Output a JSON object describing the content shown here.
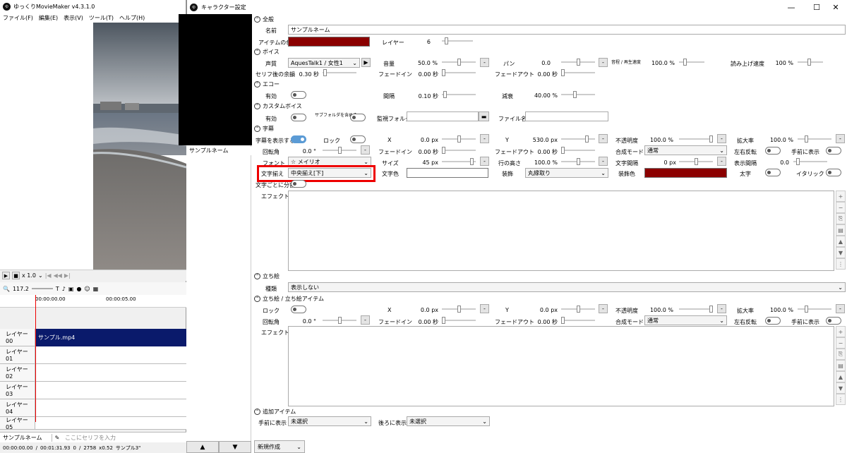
{
  "main": {
    "title": "ゆっくりMovieMaker v4.3.1.0",
    "menu": [
      "ファイル(F)",
      "編集(E)",
      "表示(V)",
      "ツール(T)",
      "ヘルプ(H)"
    ],
    "play_speed": "x 1.0",
    "zoom": "117.2",
    "ruler_t0": "00:00:00.00",
    "ruler_t1": "00:00:05.00",
    "layers": [
      "レイヤー 00",
      "レイヤー 01",
      "レイヤー 02",
      "レイヤー 03",
      "レイヤー 04",
      "レイヤー 05"
    ],
    "clip_label": "サンプル.mp4",
    "character_select": "サンプルネーム",
    "serif_placeholder": "ここにセリフを入力",
    "status": [
      "00:00:00.00",
      "/",
      "00:01:31.93",
      "0",
      "/",
      "2758",
      "x0.52",
      "サンプル3\""
    ]
  },
  "char": {
    "title": "キャラクター設定",
    "list_item": "サンプルネーム",
    "sections": {
      "general": "全般",
      "voice": "ボイス",
      "echo": "エコー",
      "custom_voice": "カスタムボイス",
      "subtitle": "字幕",
      "standing": "立ち絵",
      "standing_item": "立ち絵 / 立ち絵アイテム",
      "extra": "追加アイテム"
    },
    "general": {
      "name_label": "名前",
      "name_value": "サンプルネーム",
      "color_label": "アイテムの色",
      "item_color": "#8b0000",
      "layer_label": "レイヤー",
      "layer_value": "6"
    },
    "voice": {
      "voice_label": "声質",
      "voice_value": "AquesTalk1 / 女性1",
      "volume_label": "音量",
      "volume_value": "50.0 %",
      "pan_label": "パン",
      "pan_value": "0.0",
      "play_speed_label": "音程 / 再生速度",
      "play_speed_value": "100.0 %",
      "read_speed_label": "読み上げ速度",
      "read_speed_value": "100 %",
      "after_label": "セリフ後の余韻",
      "after_value": "0.30 秒",
      "fadein_label": "フェードイン",
      "fadein_value": "0.00 秒",
      "fadeout_label": "フェードアウト",
      "fadeout_value": "0.00 秒"
    },
    "echo": {
      "enabled_label": "有効",
      "interval_label": "間隔",
      "interval_value": "0.10 秒",
      "decay_label": "減衰",
      "decay_value": "40.00 %"
    },
    "custom": {
      "enabled_label": "有効",
      "use_default_label": "サブフォルダを含める",
      "watch_label": "監視フォルダ",
      "file_label": "ファイル名"
    },
    "subtitle": {
      "show_label": "字幕を表示する",
      "lock_label": "ロック",
      "x_label": "X",
      "x_value": "0.0 px",
      "y_label": "Y",
      "y_value": "530.0 px",
      "opacity_label": "不透明度",
      "opacity_value": "100.0 %",
      "zoom_label": "拡大率",
      "zoom_value": "100.0 %",
      "rotate_label": "回転角",
      "rotate_value": "0.0 °",
      "fadein_label": "フェードイン",
      "fadein_value": "0.00 秒",
      "fadeout_label": "フェードアウト",
      "fadeout_value": "0.00 秒",
      "blend_label": "合成モード",
      "blend_value": "通常",
      "flip_label": "左右反転",
      "front_label": "手前に表示",
      "font_label": "フォント",
      "font_value": "メイリオ",
      "size_label": "サイズ",
      "size_value": "45 px",
      "line_label": "行の高さ",
      "line_value": "100.0 %",
      "char_spacing_label": "文字間隔",
      "char_spacing_value": "0 px",
      "display_spacing_label": "表示間隔",
      "display_spacing_value": "0.0",
      "align_label": "文字揃え",
      "align_value": "中央揃え[下]",
      "text_color_label": "文字色",
      "deco_label": "装飾",
      "deco_value": "丸縁取り",
      "deco_color_label": "装飾色",
      "deco_color": "#8b0000",
      "bold_label": "太字",
      "italic_label": "イタリック",
      "split_label": "文字ごとに分割",
      "effect_label": "エフェクト"
    },
    "standing": {
      "kind_label": "種類",
      "kind_value": "表示しない"
    },
    "standing_item": {
      "lock_label": "ロック",
      "x_label": "X",
      "x_value": "0.0 px",
      "y_label": "Y",
      "y_value": "0.0 px",
      "opacity_label": "不透明度",
      "opacity_value": "100.0 %",
      "zoom_label": "拡大率",
      "zoom_value": "100.0 %",
      "rotate_label": "回転角",
      "rotate_value": "0.0 °",
      "fadein_label": "フェードイン",
      "fadein_value": "0.00 秒",
      "fadeout_label": "フェードアウト",
      "fadeout_value": "0.00 秒",
      "blend_label": "合成モード",
      "blend_value": "通常",
      "flip_label": "左右反転",
      "front_label": "手前に表示",
      "effect_label": "エフェクト"
    },
    "extra": {
      "front_label": "手前に表示",
      "front_value": "未選択",
      "back_label": "後ろに表示",
      "back_value": "未選択"
    },
    "new_button": "新規作成"
  }
}
